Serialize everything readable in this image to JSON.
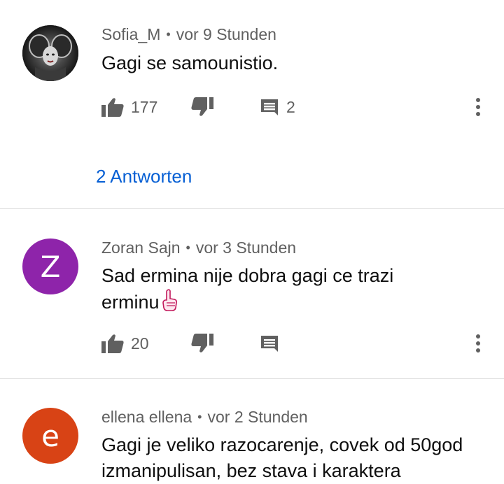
{
  "comments": [
    {
      "author": "Sofia_M",
      "separator": "•",
      "time": "vor 9 Stunden",
      "text": "Gagi se samounistio.",
      "likes": "177",
      "reply_count": "2",
      "replies_link": "2 Antworten",
      "avatar": {
        "type": "image",
        "icon": "photo-avatar"
      }
    },
    {
      "author": "Zoran Sajn",
      "separator": "•",
      "time": "vor 3 Stunden",
      "text_line1": "Sad ermina nije dobra gagi ce trazi",
      "text_line2": "erminu",
      "emoji": "☝",
      "likes": "20",
      "avatar": {
        "type": "letter",
        "letter": "Z",
        "color": "#8e24aa"
      }
    },
    {
      "author": "ellena ellena",
      "separator": "•",
      "time": "vor 2 Stunden",
      "text_line1": "Gagi je veliko razocarenje, covek od 50god",
      "text_line2": "izmanipulisan, bez stava i karaktera",
      "avatar": {
        "type": "letter",
        "letter": "e",
        "color": "#d84315"
      }
    }
  ],
  "icons": {
    "like": "thumb-up-icon",
    "dislike": "thumb-down-icon",
    "reply": "comment-icon",
    "more": "more-vertical-icon"
  },
  "colors": {
    "link": "#065fd4",
    "icon": "#606060",
    "divider": "#dcdcdc"
  }
}
